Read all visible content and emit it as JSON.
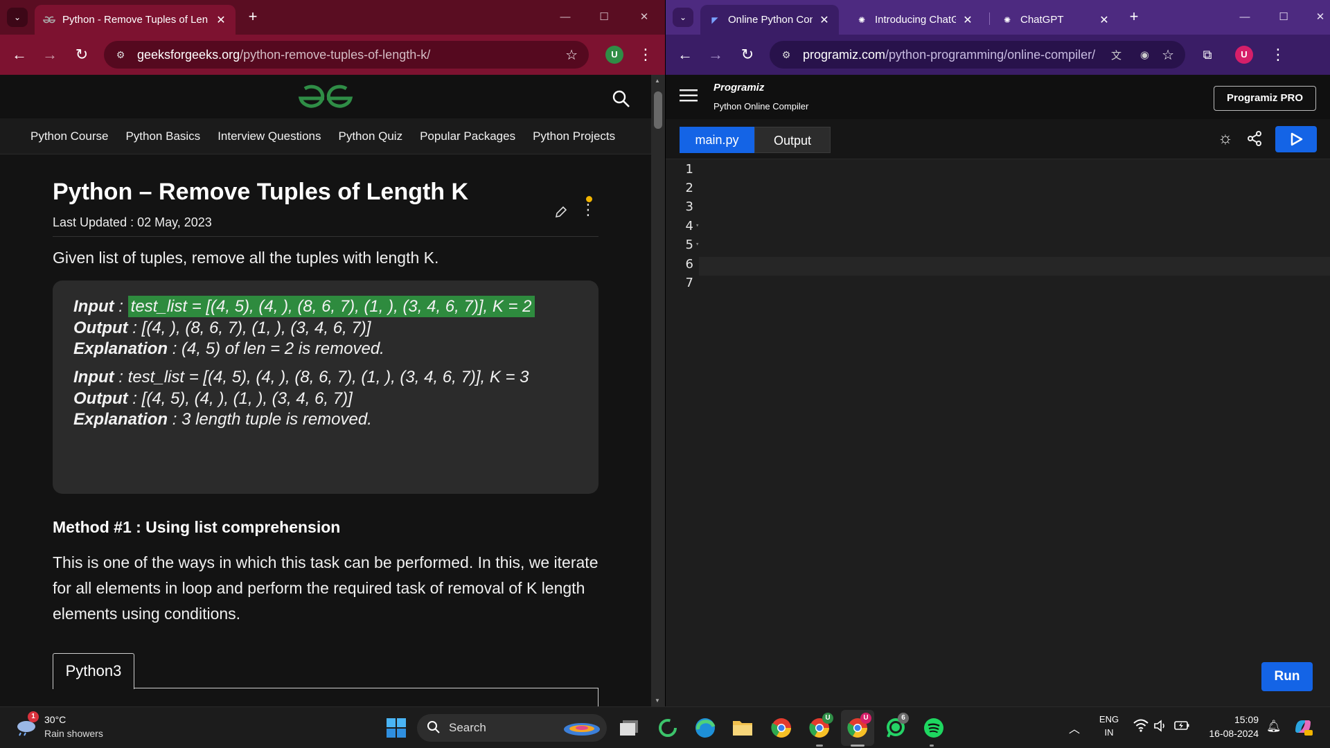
{
  "left_browser": {
    "tab_title": "Python - Remove Tuples of Len",
    "url_host": "geeksforgeeks.org",
    "url_path": "/python-remove-tuples-of-length-k/",
    "profile_initial": "U",
    "colors": {
      "frame": "#5a0d22",
      "toolbar": "#7d1230"
    }
  },
  "gfg": {
    "logo": "GfG",
    "nav": [
      "Python Course",
      "Python Basics",
      "Interview Questions",
      "Python Quiz",
      "Popular Packages",
      "Python Projects"
    ],
    "title": "Python – Remove Tuples of Length K",
    "last_updated": "Last Updated : 02 May, 2023",
    "intro": "Given list of tuples, remove all the tuples with length K.",
    "examples": [
      {
        "input_label": "Input",
        "input": "test_list = [(4, 5), (4, ), (8, 6, 7), (1, ), (3, 4, 6, 7)], K = 2",
        "output_label": "Output",
        "output": "[(4, ), (8, 6, 7), (1, ), (3, 4, 6, 7)]",
        "explanation_label": "Explanation",
        "explanation": "(4, 5) of len = 2 is removed."
      },
      {
        "input_label": "Input",
        "input": "test_list = [(4, 5), (4, ), (8, 6, 7), (1, ), (3, 4, 6, 7)], K = 3",
        "output_label": "Output",
        "output": "[(4, 5), (4, ), (1, ), (3, 4, 6, 7)]",
        "explanation_label": "Explanation",
        "explanation": "3 length tuple is removed."
      }
    ],
    "method_heading": "Method #1 : Using list comprehension",
    "method_text": "This is one of the ways in which this task can be performed. In this, we iterate for all elements in loop and perform the required task of removal of K length elements using conditions.",
    "code_tab": "Python3",
    "accent": "#2f8d46"
  },
  "right_browser": {
    "tabs": [
      "Online Python Con",
      "Introducing ChatG",
      "ChatGPT"
    ],
    "url_host": "programiz.com",
    "url_path": "/python-programming/online-compiler/",
    "profile_initial": "U",
    "colors": {
      "frame": "#4d2a80",
      "toolbar": "#3a1d66"
    }
  },
  "programiz": {
    "brand": "Programiz",
    "subtitle": "Python Online Compiler",
    "pro_button": "Programiz PRO",
    "file_tab": "main.py",
    "output_tab": "Output",
    "run_label": "Run",
    "line_numbers": [
      "1",
      "2",
      "3",
      "4",
      "5",
      "6",
      "7"
    ],
    "accent": "#1464e6"
  },
  "taskbar": {
    "weather_temp": "30°C",
    "weather_desc": "Rain showers",
    "weather_badge": "1",
    "search_label": "Search",
    "lang_top": "ENG",
    "lang_bottom": "IN",
    "time": "15:09",
    "date": "16-08-2024",
    "whatsapp_badge": "6",
    "chrome_badge_1": "U",
    "chrome_badge_2": "U"
  }
}
